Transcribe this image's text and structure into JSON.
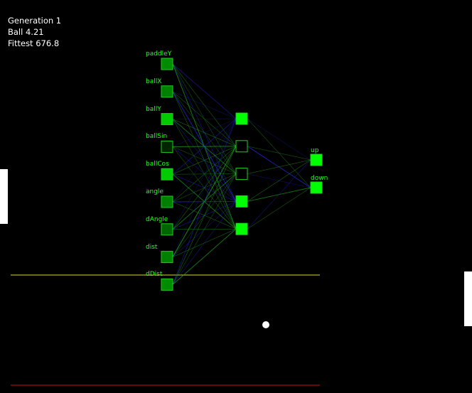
{
  "hud": {
    "generation": "Generation 1",
    "ball": "Ball 4.21",
    "fittest": "Fittest 676.8"
  },
  "network": {
    "inputs": [
      {
        "label": "paddleY",
        "level": 0.55
      },
      {
        "label": "ballX",
        "level": 0.5
      },
      {
        "label": "ballY",
        "level": 0.8
      },
      {
        "label": "ballSin",
        "level": 0.15
      },
      {
        "label": "ballCos",
        "level": 0.8
      },
      {
        "label": "angle",
        "level": 0.5
      },
      {
        "label": "dAngle",
        "level": 0.4
      },
      {
        "label": "dist",
        "level": 0.5
      },
      {
        "label": "dDist",
        "level": 0.55
      }
    ],
    "hidden": [
      {
        "level": 1.0
      },
      {
        "level": 0.0
      },
      {
        "level": 0.0
      },
      {
        "level": 1.0
      },
      {
        "level": 1.0
      }
    ],
    "outputs": [
      {
        "label": "up",
        "level": 1.0
      },
      {
        "label": "down",
        "level": 1.0
      }
    ]
  },
  "colors": {
    "background": "#000000",
    "node_active": "#00ff00",
    "node_outline": "#22cc22",
    "weight_positive": "#22aa22",
    "weight_negative": "#2222cc",
    "boundary_top": "#dddd33",
    "boundary_bottom": "#cc1111",
    "ball": "#ffffff",
    "paddle": "#ffffff"
  }
}
